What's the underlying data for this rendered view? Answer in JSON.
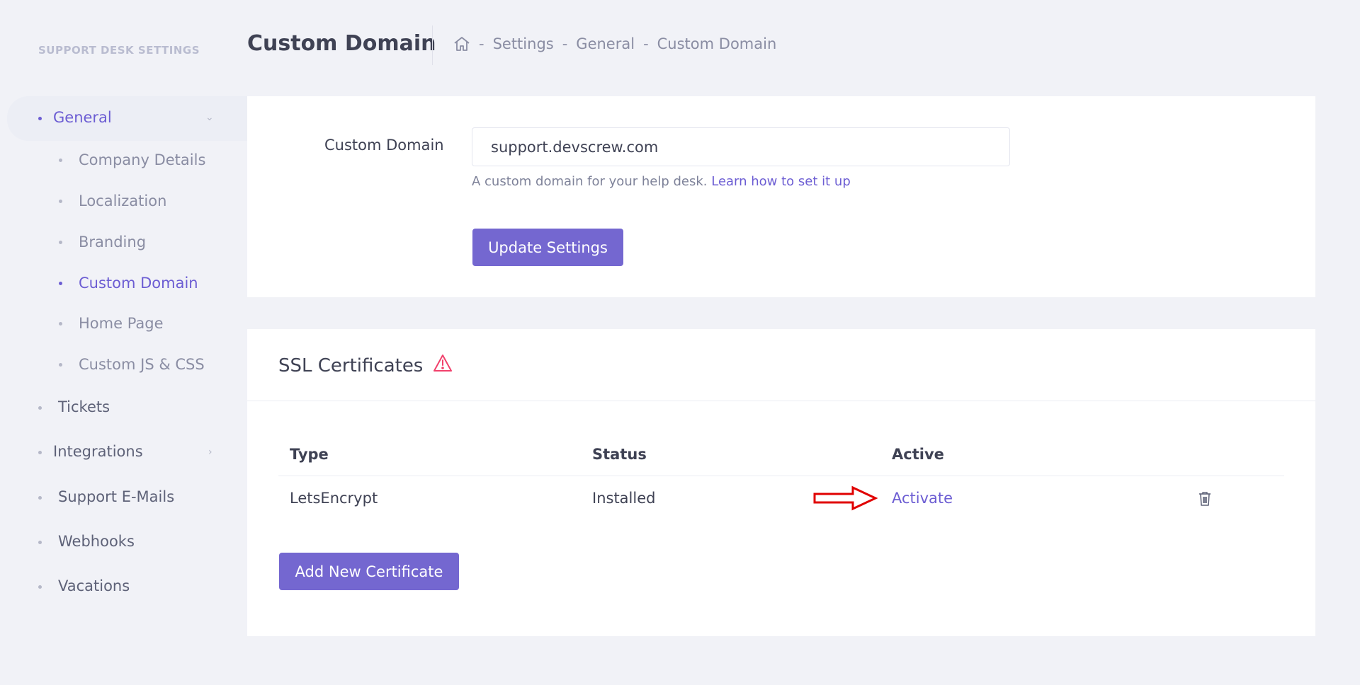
{
  "sidebar": {
    "title": "SUPPORT DESK SETTINGS",
    "items": [
      {
        "label": "General",
        "expanded": true
      },
      {
        "label": "Company Details"
      },
      {
        "label": "Localization"
      },
      {
        "label": "Branding"
      },
      {
        "label": "Custom Domain",
        "current": true
      },
      {
        "label": "Home Page"
      },
      {
        "label": "Custom JS & CSS"
      },
      {
        "label": "Tickets"
      },
      {
        "label": "Integrations"
      },
      {
        "label": "Support E-Mails"
      },
      {
        "label": "Webhooks"
      },
      {
        "label": "Vacations"
      }
    ]
  },
  "header": {
    "title": "Custom Domain",
    "breadcrumb": [
      "Settings",
      "General",
      "Custom Domain"
    ],
    "separator": "-"
  },
  "domain_card": {
    "field_label": "Custom Domain",
    "input_value": "support.devscrew.com",
    "hint_text": "A custom domain for your help desk.",
    "hint_link": "Learn how to set it up",
    "update_button": "Update Settings"
  },
  "ssl_card": {
    "title": "SSL Certificates",
    "warning_icon": "warning-icon",
    "columns": [
      "Type",
      "Status",
      "Active"
    ],
    "rows": [
      {
        "type": "LetsEncrypt",
        "status": "Installed",
        "action": "Activate"
      }
    ],
    "add_button": "Add New Certificate"
  },
  "colors": {
    "accent": "#6c5dd3",
    "button": "#7467d0",
    "background": "#f1f2f7",
    "annotation_arrow": "#e00000",
    "warning": "#f1416c"
  }
}
